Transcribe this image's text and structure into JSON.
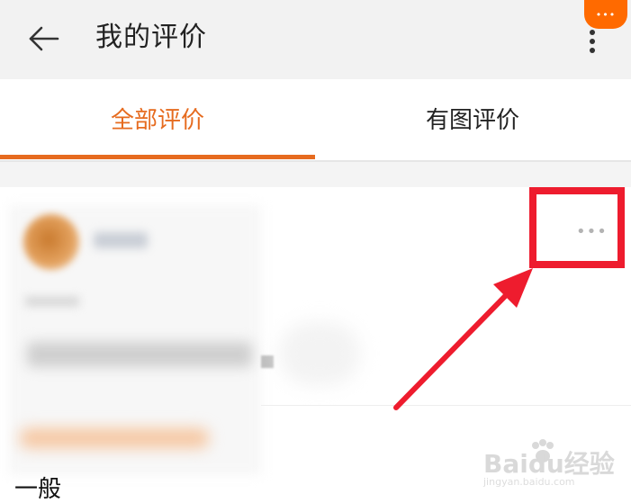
{
  "header": {
    "back_icon": "arrow-left-icon",
    "title": "我的评价",
    "more_icon": "more-vertical-icon"
  },
  "badge": {
    "icon": "more-horizontal-icon",
    "color": "#ff6a00"
  },
  "tabs": [
    {
      "label": "全部评价",
      "active": true
    },
    {
      "label": "有图评价",
      "active": false
    }
  ],
  "review": {
    "more_label": "•••"
  },
  "bottom": {
    "label": "一般"
  },
  "watermark": {
    "logo_text": "Baidu经验",
    "sub_text": "jingyan.baidu.com"
  },
  "colors": {
    "accent": "#e66b1f",
    "highlight": "#ee1c2e",
    "header_bg": "#f2f2f2"
  }
}
